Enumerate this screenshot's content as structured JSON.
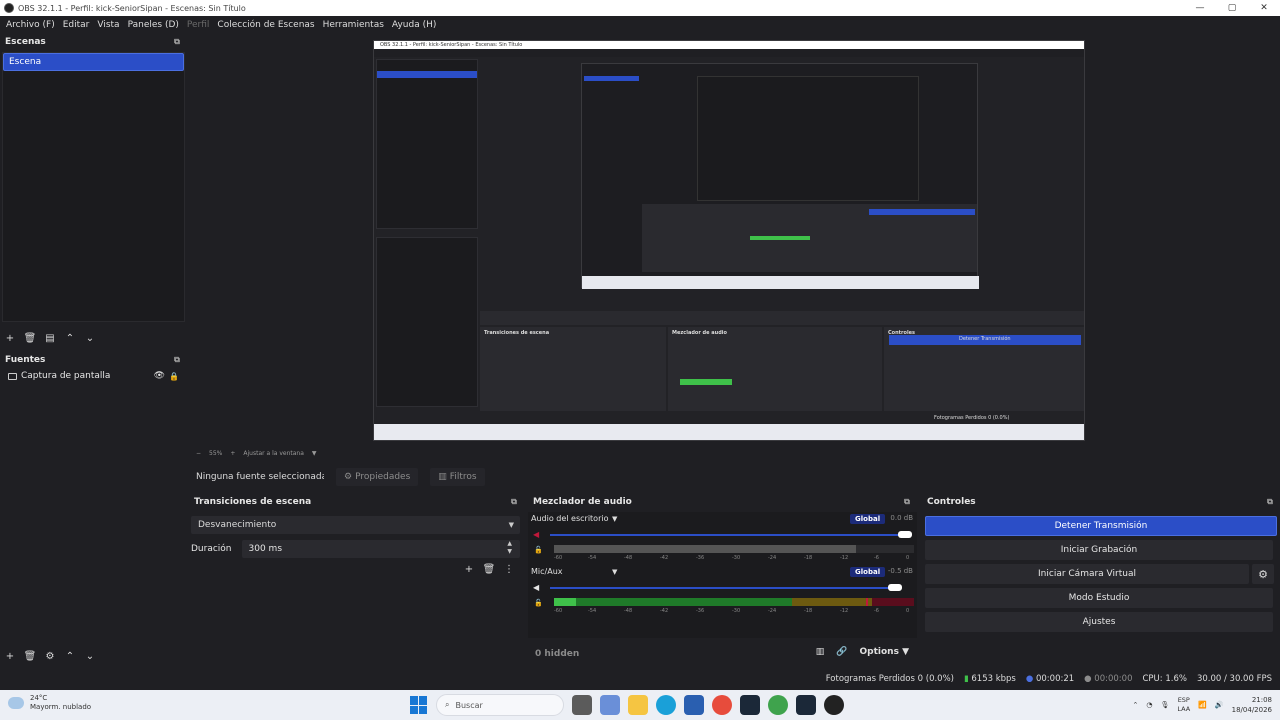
{
  "window": {
    "title": "OBS 32.1.1 - Perfil: kick-SeniorSipan - Escenas: Sin Título",
    "controls": [
      "—",
      "▢",
      "✕"
    ]
  },
  "menu": {
    "items": [
      "Archivo (F)",
      "Editar",
      "Vista",
      "Paneles (D)",
      "Perfil",
      "Colección de Escenas",
      "Herramientas",
      "Ayuda (H)"
    ]
  },
  "scenes": {
    "title": "Escenas",
    "items": [
      "Escena"
    ]
  },
  "sources": {
    "title": "Fuentes",
    "items": [
      {
        "label": "Captura de pantalla",
        "visible": true,
        "locked": true
      }
    ]
  },
  "preview": {
    "zoom": "55%",
    "fit_label": "Ajustar a la ventana"
  },
  "context": {
    "no_source": "Ninguna fuente seleccionada",
    "properties": "Propiedades",
    "filters": "Filtros"
  },
  "transitions": {
    "title": "Transiciones de escena",
    "selected": "Desvanecimiento",
    "duration_label": "Duración",
    "duration_value": "300 ms"
  },
  "mixer": {
    "title": "Mezclador de audio",
    "channels": [
      {
        "name": "Audio del escritorio",
        "badge": "Global",
        "db": "0.0 dB",
        "volume": 1.0,
        "muted": true
      },
      {
        "name": "Mic/Aux",
        "badge": "Global",
        "db": "-0.5 dB",
        "volume": 0.98,
        "muted": false
      }
    ],
    "scale": [
      "-60",
      "-54",
      "-48",
      "-42",
      "-36",
      "-30",
      "-24",
      "-18",
      "-12",
      "-6",
      "0"
    ],
    "hidden": "0 hidden",
    "options": "Options"
  },
  "controls": {
    "title": "Controles",
    "stop_stream": "Detener Transmisión",
    "start_recording": "Iniciar Grabación",
    "virtual_cam": "Iniciar Cámara Virtual",
    "studio_mode": "Modo Estudio",
    "settings": "Ajustes"
  },
  "status": {
    "dropped": "Fotogramas Perdidos 0 (0.0%)",
    "bitrate": "6153 kbps",
    "stream_time": "00:00:21",
    "rec_time": "00:00:00",
    "cpu": "CPU: 1.6%",
    "fps": "30.00 / 30.00 FPS"
  },
  "taskbar": {
    "temperature": "24°C",
    "weather": "Mayorm. nublado",
    "search_placeholder": "Buscar",
    "lang_1": "ESP",
    "lang_2": "LAA",
    "time": "21:08",
    "date": "18/04/2026"
  },
  "colors": {
    "accent": "#2b4ec7",
    "background": "#1f1f23",
    "meter_green": "#3fc14a",
    "meter_red": "#c0183a"
  }
}
